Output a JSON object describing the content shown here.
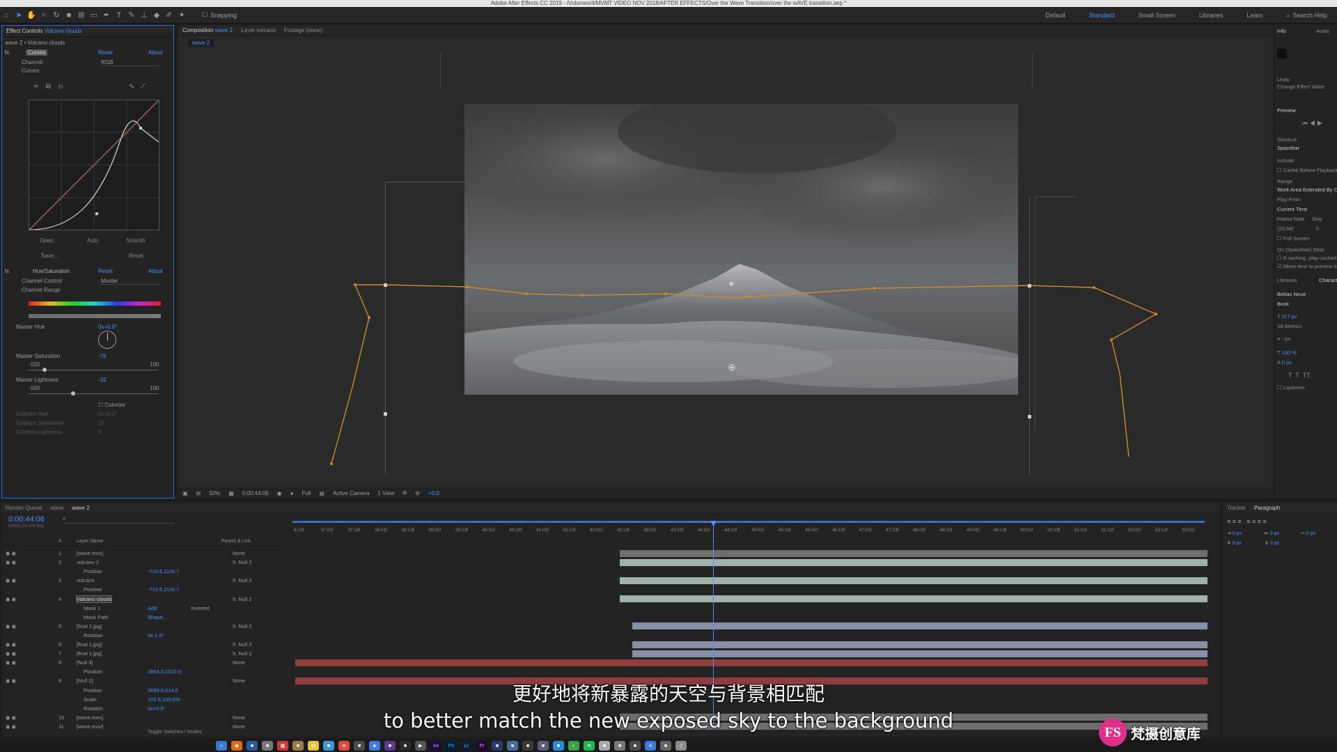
{
  "app": {
    "title": "Adobe After Effects CC 2019 - /Volumes/4/MVMT VIDEO NOV 2018/AFTER EFFECTS/Over the Wave Transition/over the wAVE transition.aep *"
  },
  "toolbar": {
    "snapping": "Snapping",
    "workspaces": [
      "Default",
      "Standard",
      "Small Screen",
      "Libraries",
      "Learn"
    ],
    "search_placeholder": "Search Help"
  },
  "effect_controls": {
    "tab_label": "Effect Controls",
    "tab_layer": "Volcano clouds",
    "breadcrumb": "wave 2 • Volcano clouds",
    "curves": {
      "name": "Curves",
      "reset": "Reset",
      "about": "About",
      "channel_label": "Channel:",
      "channel_value": "RGB",
      "curves_label": "Curves",
      "buttons": [
        "Open...",
        "Auto",
        "Smooth",
        "Save...",
        "Reset"
      ]
    },
    "hue_sat": {
      "name": "Hue/Saturation",
      "reset": "Reset",
      "about": "About",
      "channel_control_label": "Channel Control",
      "channel_control_value": "Master",
      "channel_range": "Channel Range",
      "master_hue": "Master Hue",
      "master_hue_value": "0x+0.0°",
      "master_saturation": "Master Saturation",
      "master_saturation_value": "-78",
      "master_lightness": "Master Lightness",
      "master_lightness_value": "-32",
      "min": "-100",
      "max": "100",
      "saturation_level": 0.11,
      "lightness_level": 0.34,
      "colorize": "Colorize",
      "colorize_hue": "Colorize Hue",
      "colorize_hue_value": "0x+0.0°",
      "colorize_saturation": "Colorize Saturation",
      "colorize_saturation_value": "25",
      "colorize_lightness": "Colorize Lightness",
      "colorize_lightness_value": "0"
    }
  },
  "composition": {
    "tabs": [
      "Composition",
      "wave 2",
      "Layer volcano",
      "Footage (none)"
    ],
    "comp_tab": "wave 2",
    "footer": {
      "zoom": "50%",
      "time": "0:00:44:06",
      "resolution": "Full",
      "camera": "Active Camera",
      "view": "1 View",
      "exposure": "+0.0"
    }
  },
  "right_panel": {
    "info": "Info",
    "audio": "Audio",
    "undo": "Undo",
    "undo_action": "Change Effect Value",
    "preview": "Preview",
    "shortcut": "Shortcut",
    "shortcut_value": "Spacebar",
    "include": "Include:",
    "cache_before": "Cache Before Playback",
    "range": "Range",
    "range_value": "Work Area Extended By Current...",
    "play_from": "Play From",
    "play_from_value": "Current Time",
    "frame_rate": "Frame Rate",
    "skip": "Skip",
    "frame_rate_value": "(23.98)",
    "skip_value": "0",
    "full_screen": "Full Screen",
    "on_stop": "On (Spacebar) Stop:",
    "if_caching": "If caching, play cached frames",
    "move_time": "Move time to preview time",
    "libraries": "Libraries",
    "character": "Character",
    "font": "Bebas Neue",
    "style": "Book",
    "font_size": "117 px",
    "tracking": "Metrics",
    "leading": "- px",
    "vscale": "100 %",
    "baseline": "0 px",
    "ligatures": "Ligatures"
  },
  "timeline": {
    "tabs": [
      "Render Queue",
      "wave",
      "wave 2"
    ],
    "timecode": "0:00:44:06",
    "frame_info": "01063 (23.976 fps)",
    "columns": {
      "num": "#",
      "layer_name": "Layer Name",
      "parent": "Parent & Link"
    },
    "ruler": [
      "6:13f",
      "37:01f",
      "37:13f",
      "38:01f",
      "38:13f",
      "39:01f",
      "39:13f",
      "40:01f",
      "40:13f",
      "41:01f",
      "41:13f",
      "42:01f",
      "42:13f",
      "43:01f",
      "43:13f",
      "44:01f",
      "44:13f",
      "45:01f",
      "45:13f",
      "46:01f",
      "46:13f",
      "47:01f",
      "47:13f",
      "48:01f",
      "48:13f",
      "49:01f",
      "49:13f",
      "50:01f",
      "50:13f",
      "51:01f",
      "51:13f",
      "52:01f",
      "52:13f",
      "53:01f"
    ],
    "layers": [
      {
        "num": "1",
        "name": "[wave.mov]",
        "parent": "None"
      },
      {
        "num": "2",
        "name": "volcano 2",
        "parent": "9. Null 2"
      },
      {
        "num": "",
        "name": "Position",
        "value": "-710.6,1116.7"
      },
      {
        "num": "3",
        "name": "volcano",
        "parent": "9. Null 2"
      },
      {
        "num": "",
        "name": "Position",
        "value": "-710.6,1116.7"
      },
      {
        "num": "4",
        "name": "Volcano clouds",
        "parent": "9. Null 2"
      },
      {
        "num": "",
        "name": "Mask 1",
        "value": "Add",
        "extra": "Inverted"
      },
      {
        "num": "",
        "name": "Mask Path",
        "value": "Shape..."
      },
      {
        "num": "5",
        "name": "[final 1.jpg]",
        "parent": "9. Null 2"
      },
      {
        "num": "",
        "name": "Rotation",
        "value": "0x-1.5°"
      },
      {
        "num": "6",
        "name": "[final 1.jpg]",
        "parent": "9. Null 2"
      },
      {
        "num": "7",
        "name": "[final 1.jpg]",
        "parent": "9. Null 2"
      },
      {
        "num": "8",
        "name": "[Null 3]",
        "parent": "None"
      },
      {
        "num": "",
        "name": "Position",
        "value": "2854.0,1510.0"
      },
      {
        "num": "9",
        "name": "[Null 2]",
        "parent": "None"
      },
      {
        "num": "",
        "name": "Position",
        "value": "2689.8,814.0"
      },
      {
        "num": "",
        "name": "Scale",
        "value": "100.6,100.6%"
      },
      {
        "num": "",
        "name": "Rotation",
        "value": "0x+0.8°"
      },
      {
        "num": "10",
        "name": "[wave.mov]",
        "parent": "None"
      },
      {
        "num": "11",
        "name": "[wave.mov]",
        "parent": "None"
      }
    ],
    "toggle": "Toggle Switches / Modes"
  },
  "tracker": {
    "tracker": "Tracker",
    "paragraph": "Paragraph",
    "indent": "0 px"
  },
  "dock_apps": [
    "Ae",
    "Ps",
    "Lr",
    "Pr"
  ],
  "subtitle": {
    "zh": "更好地将新暴露的天空与背景相匹配",
    "en": "to better match the new exposed sky to the background"
  },
  "watermark": {
    "text": "梵摄创意库",
    "logo": "FS"
  },
  "colors": {
    "accent": "#4a90ff",
    "mask_path": "#d08a28",
    "null_layer": "#8e3c3c",
    "layer_bar": "#9fb2ae"
  }
}
